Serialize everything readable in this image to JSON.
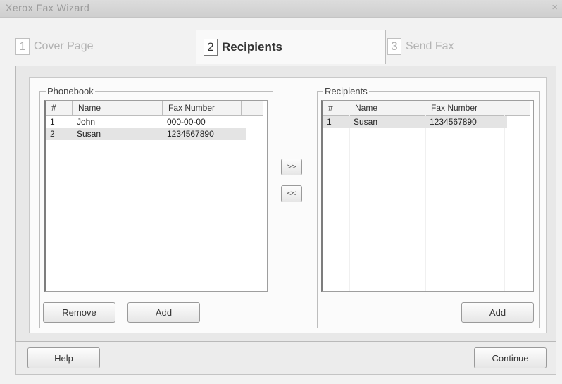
{
  "window": {
    "title": "Xerox Fax Wizard",
    "close_glyph": "×"
  },
  "tabs": [
    {
      "number": "1",
      "label": "Cover Page",
      "active": false
    },
    {
      "number": "2",
      "label": "Recipients",
      "active": true
    },
    {
      "number": "3",
      "label": "Send Fax",
      "active": false
    }
  ],
  "phonebook": {
    "legend": "Phonebook",
    "columns": [
      "#",
      "Name",
      "Fax Number"
    ],
    "rows": [
      {
        "num": "1",
        "name": "John",
        "fax": "000-00-00",
        "selected": false
      },
      {
        "num": "2",
        "name": "Susan",
        "fax": "1234567890",
        "selected": true
      }
    ],
    "remove_label": "Remove",
    "add_label": "Add"
  },
  "transfer": {
    "add_all_label": ">>",
    "remove_all_label": "<<"
  },
  "recipients": {
    "legend": "Recipients",
    "columns": [
      "#",
      "Name",
      "Fax Number"
    ],
    "rows": [
      {
        "num": "1",
        "name": "Susan",
        "fax": "1234567890",
        "selected": true
      }
    ],
    "add_label": "Add"
  },
  "footer": {
    "help_label": "Help",
    "continue_label": "Continue"
  }
}
